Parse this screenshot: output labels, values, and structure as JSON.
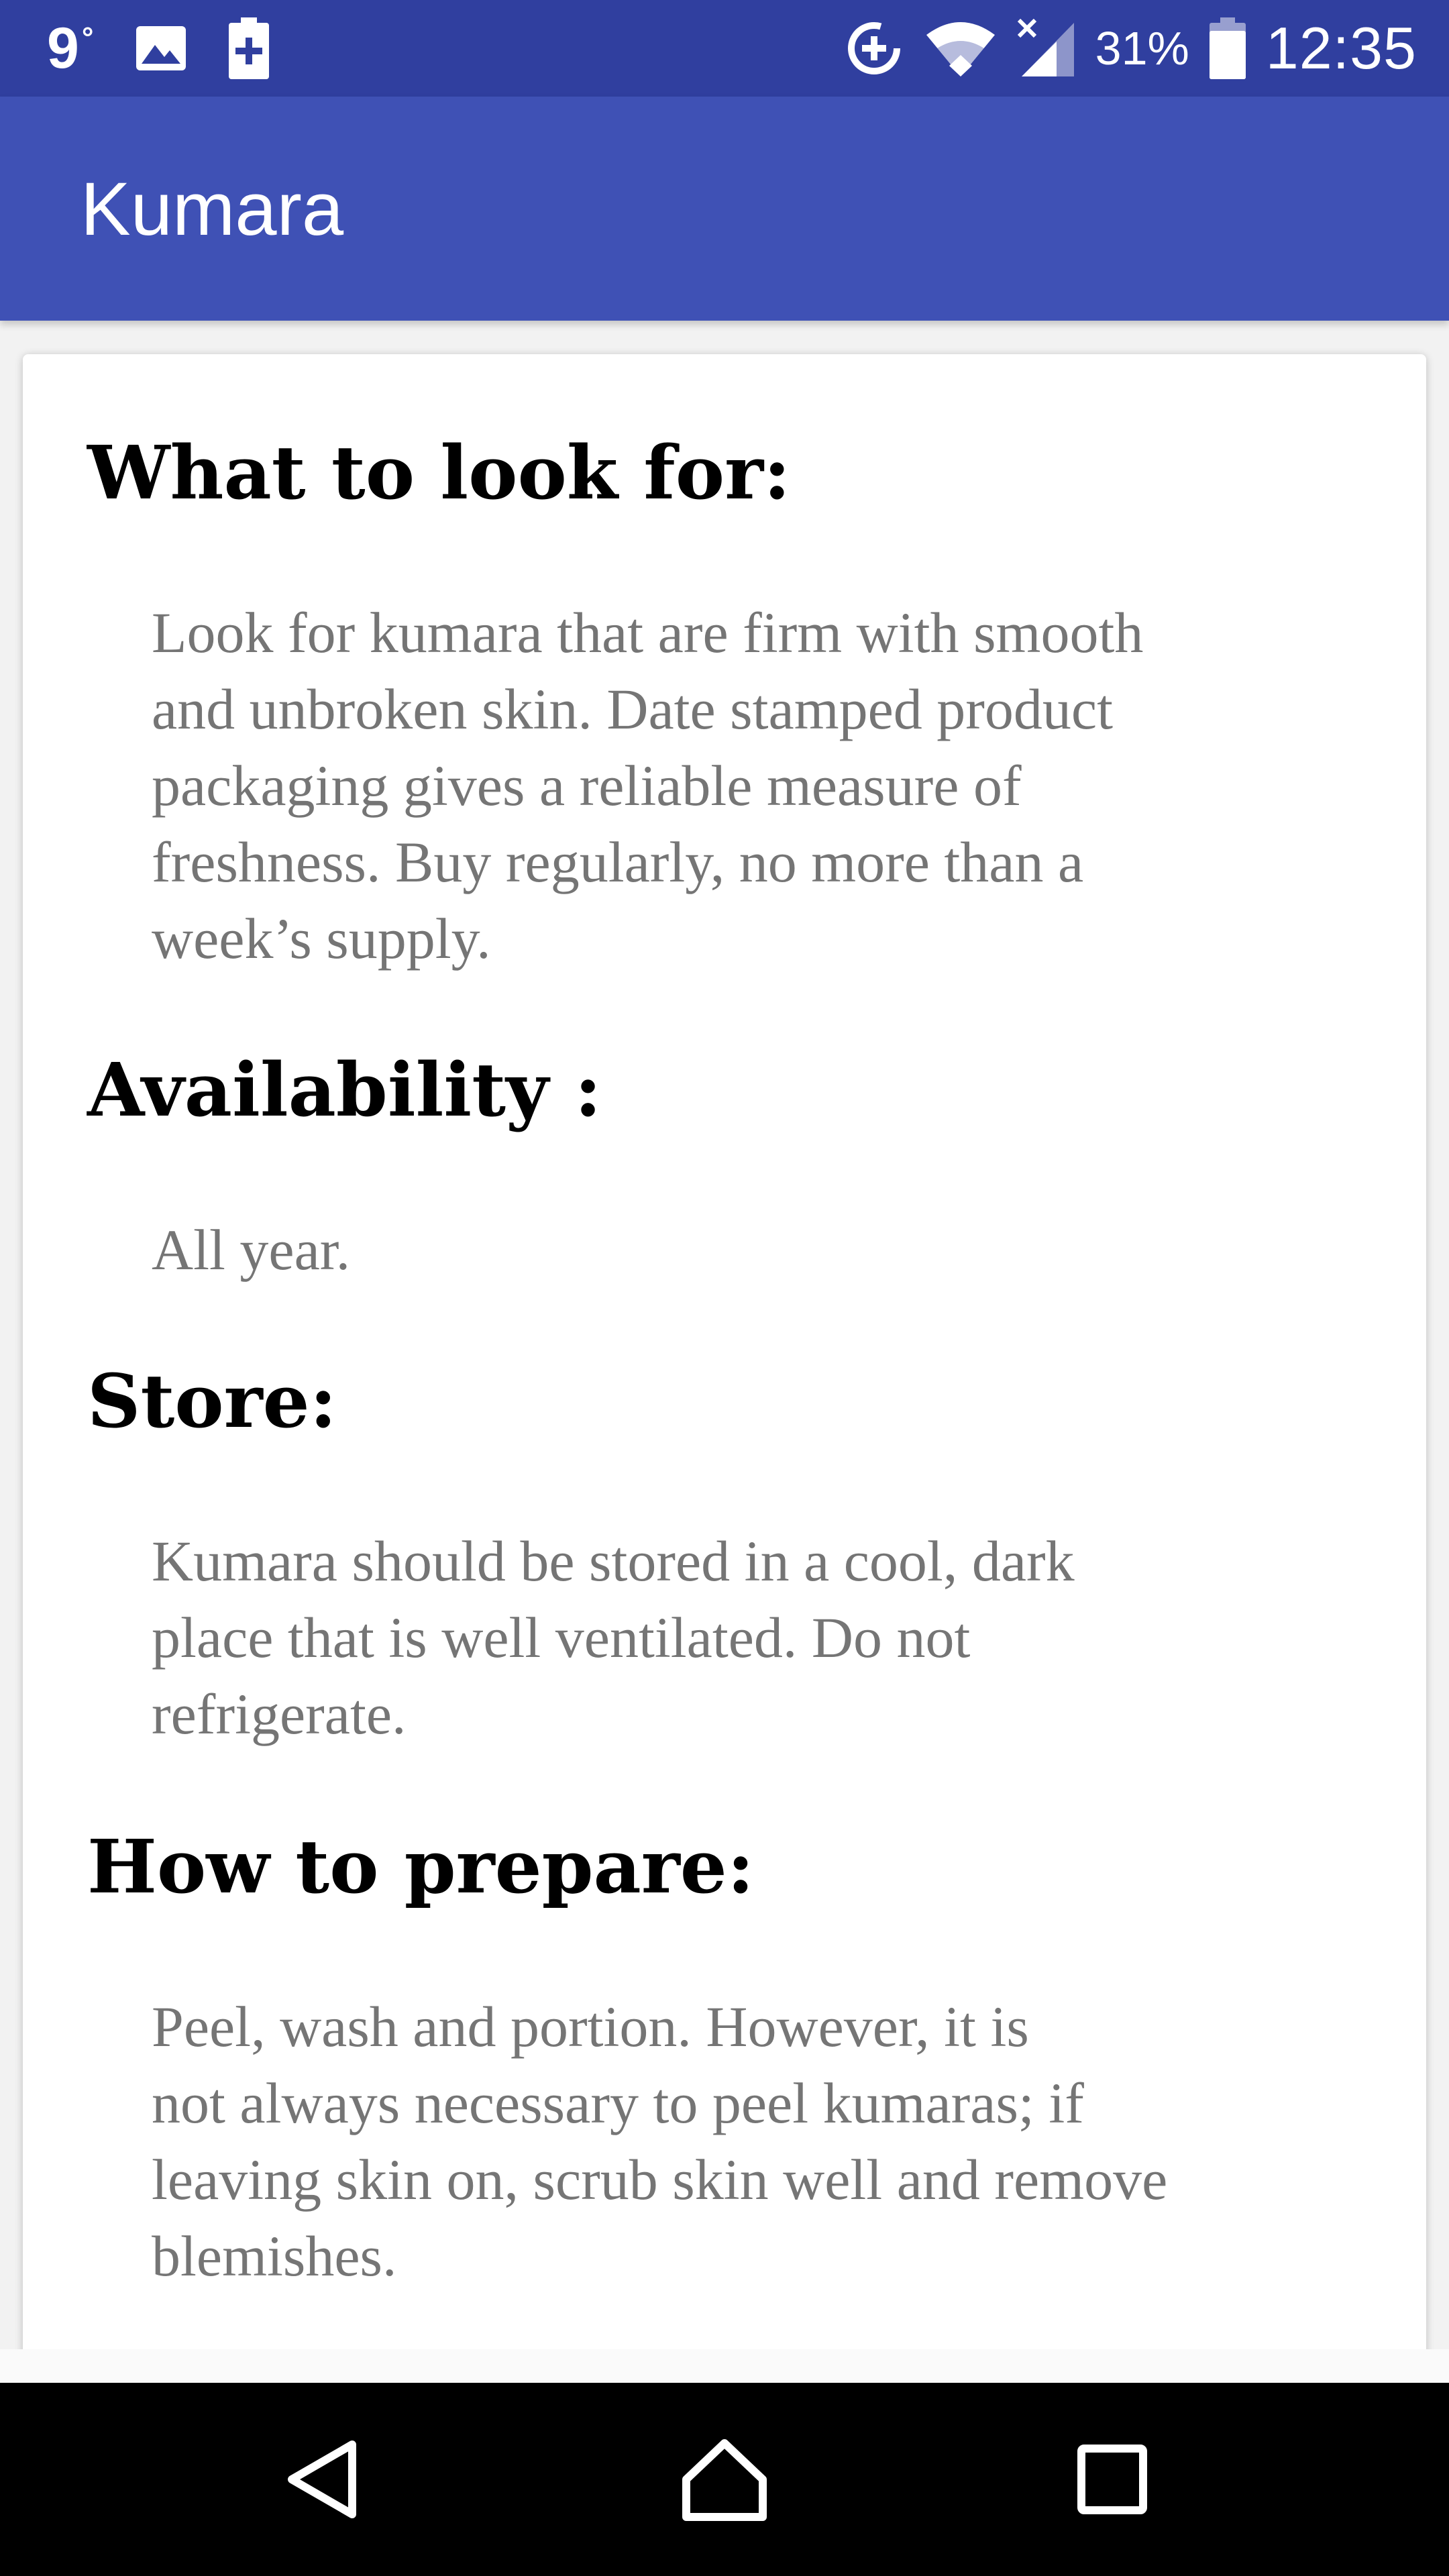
{
  "status_bar": {
    "temperature": "9",
    "degree_symbol": "°",
    "battery_percent": "31%",
    "time": "12:35",
    "icons": [
      "image-icon",
      "battery-saver-icon",
      "data-saver-icon",
      "wifi-icon",
      "signal-icon",
      "battery-icon"
    ]
  },
  "app_bar": {
    "title": "Kumara"
  },
  "sections": [
    {
      "heading": "What to look for:",
      "body": "Look for kumara that are firm with smooth\nand unbroken skin. Date stamped product\npackaging gives a reliable measure of\nfreshness. Buy regularly, no more than a\nweek’s supply."
    },
    {
      "heading": "Availability :",
      "body": "All year."
    },
    {
      "heading": "Store:",
      "body": "Kumara should be stored in a cool, dark\nplace that is well ventilated. Do not\nrefrigerate."
    },
    {
      "heading": "How to prepare:",
      "body": "Peel, wash and portion. However, it is\nnot always necessary to peel kumaras; if\nleaving skin on, scrub skin well and remove\nblemishes."
    }
  ],
  "nav_bar": {
    "icons": [
      "back-icon",
      "home-icon",
      "recents-icon"
    ]
  },
  "colors": {
    "status_bar": "#303f9f",
    "app_bar": "#3f51b5",
    "body_text": "#757575",
    "heading_text": "#000000"
  }
}
